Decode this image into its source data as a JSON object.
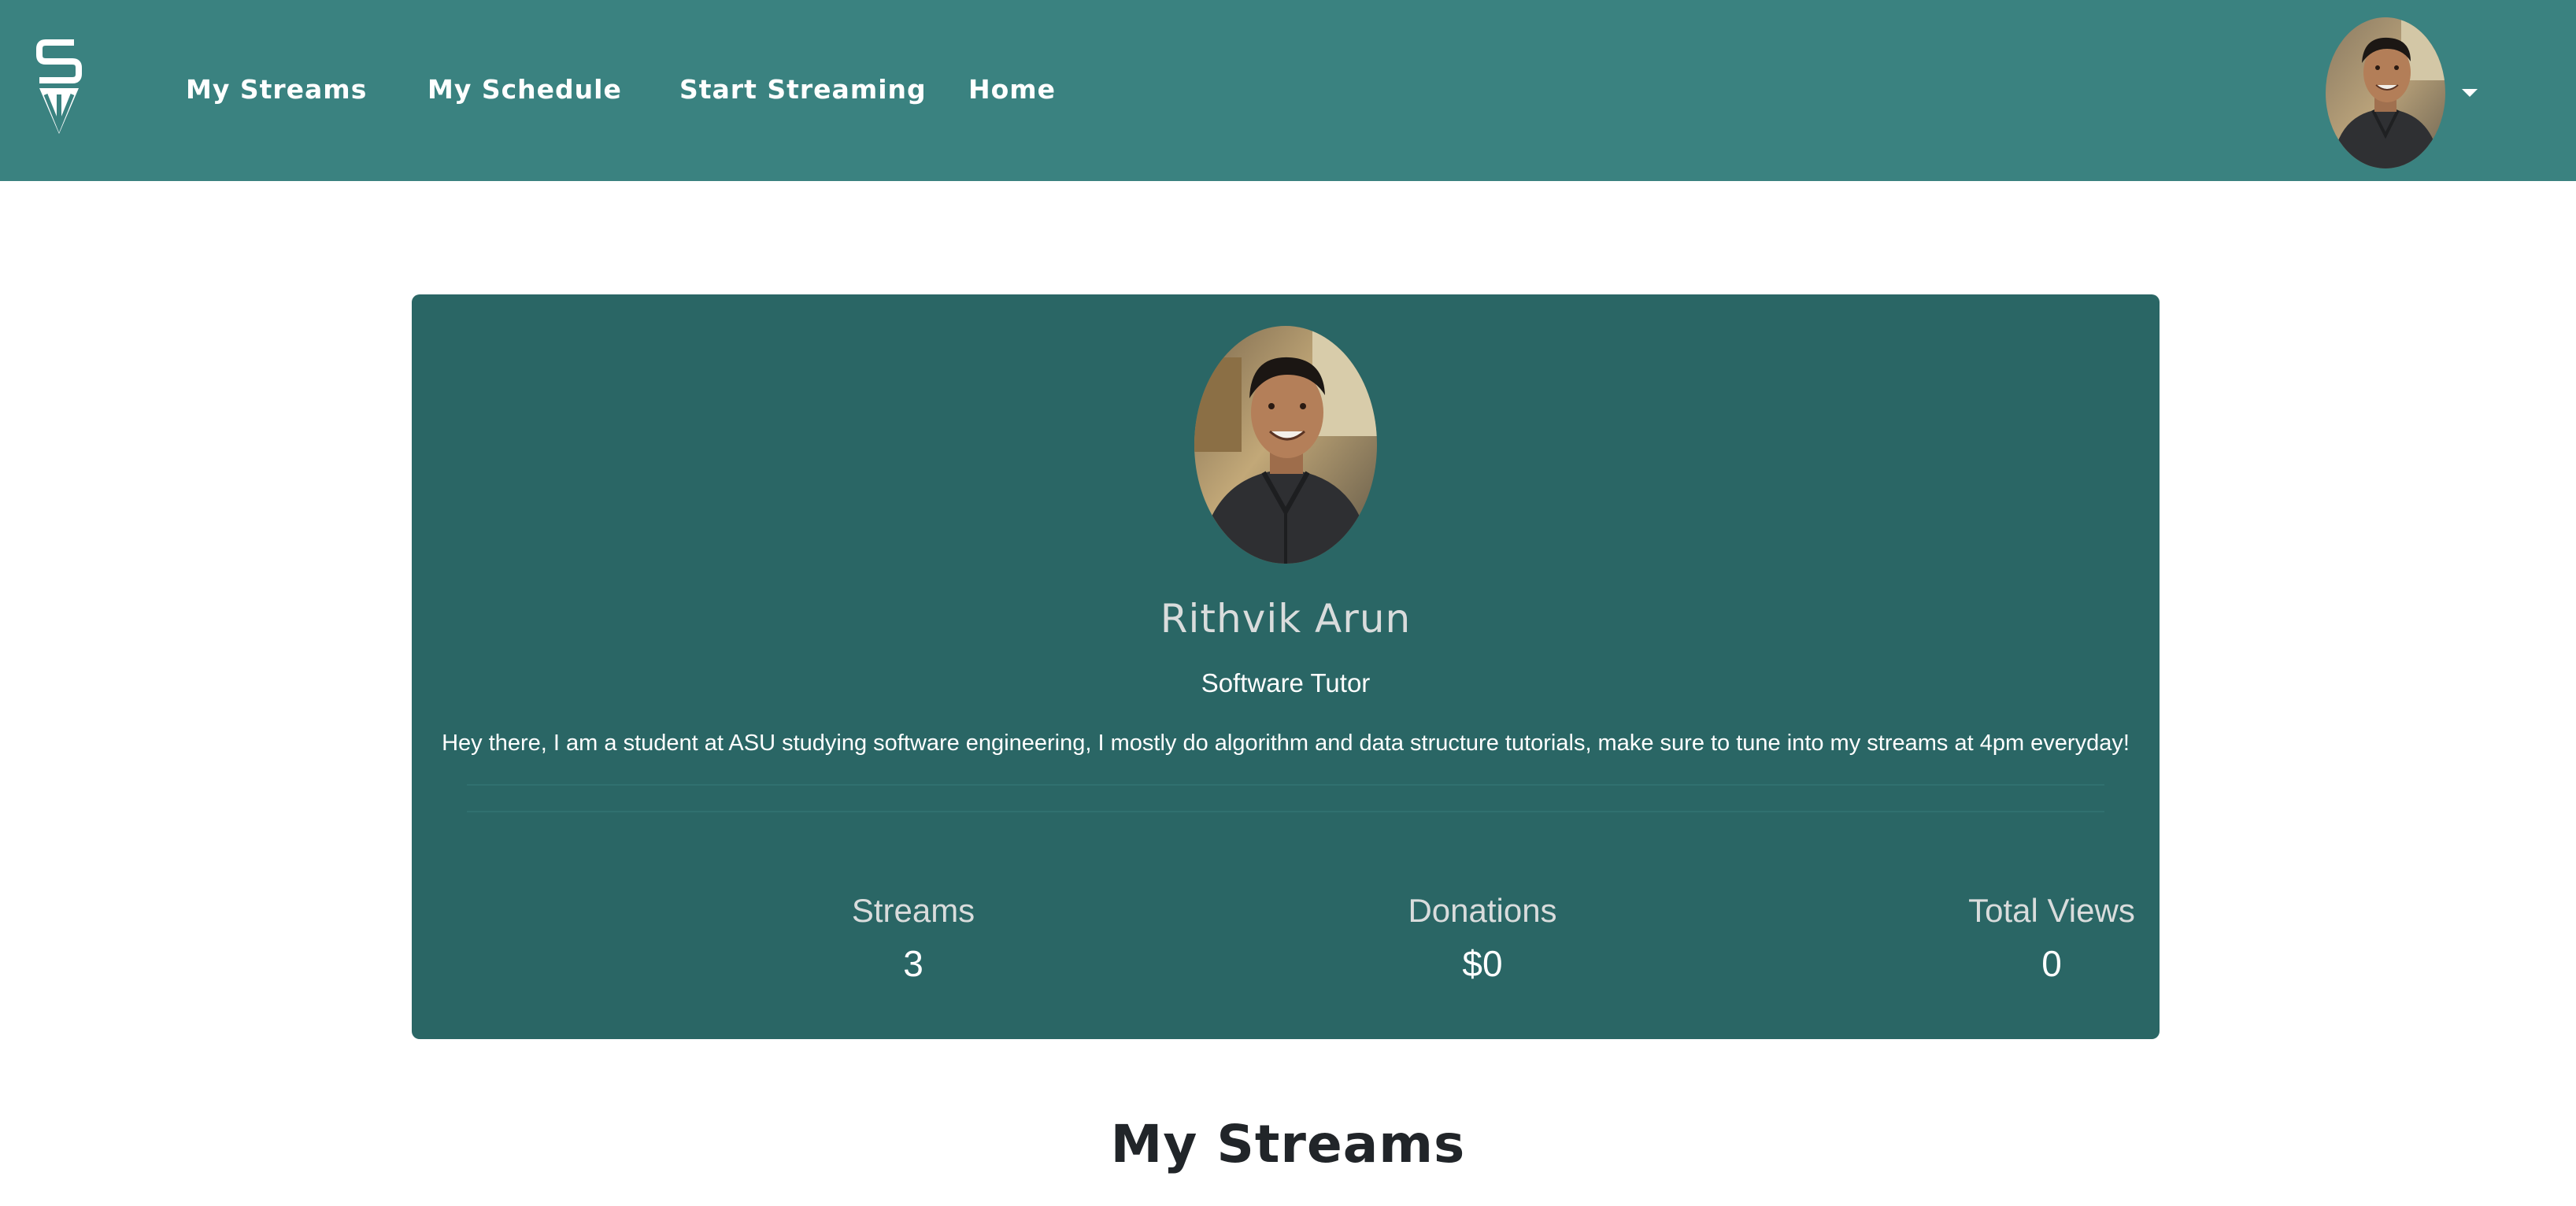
{
  "nav": {
    "logo_text": "SW",
    "links": [
      {
        "label": "My Streams"
      },
      {
        "label": "My Schedule"
      },
      {
        "label": "Start Streaming"
      },
      {
        "label": "Home"
      }
    ]
  },
  "profile": {
    "name": "Rithvik Arun",
    "title": "Software Tutor",
    "bio": "Hey there, I am a student at ASU studying software engineering, I mostly do algorithm and data structure tutorials, make sure to tune into my streams at 4pm everyday!",
    "stats": [
      {
        "label": "Streams",
        "value": "3"
      },
      {
        "label": "Donations",
        "value": "$0"
      },
      {
        "label": "Total Views",
        "value": "0"
      }
    ]
  },
  "main": {
    "section_title": "My Streams"
  },
  "icons": {
    "logo": "pen-nib-logo-icon",
    "user_avatar": "user-avatar-photo",
    "dropdown": "caret-down-icon"
  },
  "colors": {
    "navbar": "#3a8280",
    "card": "#2a6665",
    "text_light": "#ffffff",
    "heading_dark": "#212529"
  }
}
